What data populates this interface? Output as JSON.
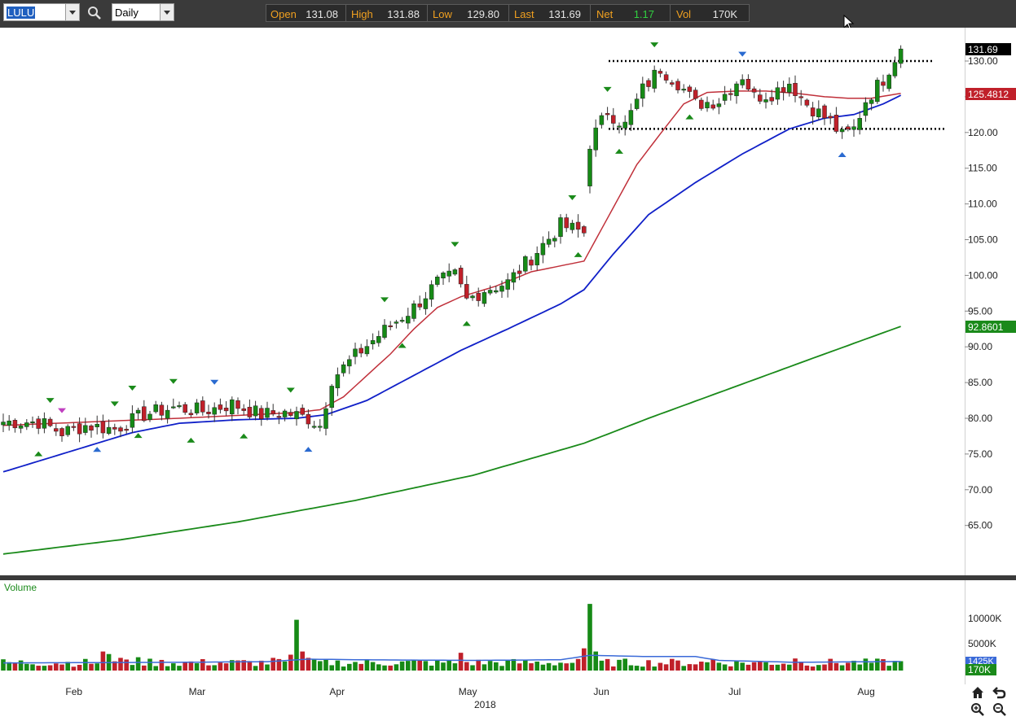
{
  "toolbar": {
    "symbol": "LULU",
    "interval": "Daily",
    "quote": [
      {
        "label": "Open",
        "value": "131.08"
      },
      {
        "label": "High",
        "value": "131.88"
      },
      {
        "label": "Low",
        "value": "129.80"
      },
      {
        "label": "Last",
        "value": "131.69"
      },
      {
        "label": "Net",
        "value": "1.17"
      },
      {
        "label": "Vol",
        "value": "170K"
      }
    ]
  },
  "colors": {
    "up": "#168a16",
    "down": "#c0202a",
    "ma_short": "#c0303a",
    "ma_mid": "#1020c8",
    "ma_long": "#1a8a1a",
    "marker_green": "#1a8a1a",
    "marker_blue": "#2a6ad0",
    "marker_magenta": "#c040c0",
    "vol_avg": "#3a6ad8"
  },
  "chart_data": {
    "type": "candlestick",
    "title": "",
    "y_ticks": [
      "130.00",
      "125.00",
      "120.00",
      "115.00",
      "110.00",
      "105.00",
      "100.00",
      "95.00",
      "90.00",
      "85.00",
      "80.00",
      "75.00",
      "70.00",
      "65.00"
    ],
    "ylim": [
      60.5,
      133.5
    ],
    "x_ticks": [
      "Feb",
      "Mar",
      "Apr",
      "May",
      "Jun",
      "Jul",
      "Aug"
    ],
    "x_year": "2018",
    "last_price_label": "131.69",
    "ma_short_label": "125.4812",
    "ma_long_label": "92.8601",
    "resistance_level": 130.0,
    "support_level": 120.5,
    "price_anchors": [
      [
        0,
        79.5
      ],
      [
        6,
        79.5
      ],
      [
        10,
        78.0
      ],
      [
        14,
        79.0
      ],
      [
        19,
        78.5
      ],
      [
        24,
        80.5
      ],
      [
        29,
        81.5
      ],
      [
        34,
        81.0
      ],
      [
        39,
        82.0
      ],
      [
        44,
        80.5
      ],
      [
        48,
        80.8
      ],
      [
        52,
        80.0
      ],
      [
        54,
        79.0
      ],
      [
        56,
        85.5
      ],
      [
        61,
        89.5
      ],
      [
        66,
        93.0
      ],
      [
        70,
        95.5
      ],
      [
        74,
        99.0
      ],
      [
        77,
        100.0
      ],
      [
        79,
        96.5
      ],
      [
        82,
        98.0
      ],
      [
        86,
        99.0
      ],
      [
        90,
        102.5
      ],
      [
        95,
        107.0
      ],
      [
        99,
        106.0
      ],
      [
        100,
        118.5
      ],
      [
        103,
        123.0
      ],
      [
        106,
        121.0
      ],
      [
        109,
        126.0
      ],
      [
        112,
        129.0
      ],
      [
        115,
        127.0
      ],
      [
        118,
        124.0
      ],
      [
        122,
        124.5
      ],
      [
        126,
        128.0
      ],
      [
        128,
        125.0
      ],
      [
        131,
        125.5
      ],
      [
        134,
        127.0
      ],
      [
        137,
        124.0
      ],
      [
        141,
        121.5
      ],
      [
        143,
        119.5
      ],
      [
        145,
        120.5
      ],
      [
        147,
        124.5
      ],
      [
        150,
        127.5
      ],
      [
        152,
        130.5
      ],
      [
        153,
        131.69
      ]
    ],
    "ma_short": [
      [
        0,
        79.0
      ],
      [
        15,
        79.5
      ],
      [
        30,
        80.0
      ],
      [
        50,
        80.8
      ],
      [
        54,
        81.2
      ],
      [
        58,
        83.0
      ],
      [
        62,
        86.0
      ],
      [
        66,
        89.0
      ],
      [
        70,
        92.5
      ],
      [
        74,
        95.5
      ],
      [
        78,
        97.0
      ],
      [
        84,
        98.5
      ],
      [
        90,
        100.5
      ],
      [
        99,
        102.0
      ],
      [
        103,
        108.0
      ],
      [
        108,
        115.5
      ],
      [
        112,
        119.8
      ],
      [
        116,
        124.0
      ],
      [
        120,
        125.6
      ],
      [
        125,
        125.8
      ],
      [
        130,
        125.8
      ],
      [
        135,
        125.5
      ],
      [
        140,
        125.0
      ],
      [
        144,
        124.8
      ],
      [
        148,
        124.8
      ],
      [
        153,
        125.48
      ]
    ],
    "ma_mid": [
      [
        0,
        72.5
      ],
      [
        14,
        76.0
      ],
      [
        22,
        78.0
      ],
      [
        30,
        79.3
      ],
      [
        40,
        79.8
      ],
      [
        50,
        80.0
      ],
      [
        55,
        80.5
      ],
      [
        62,
        82.5
      ],
      [
        70,
        86.0
      ],
      [
        78,
        89.5
      ],
      [
        86,
        92.5
      ],
      [
        95,
        96.0
      ],
      [
        99,
        98.0
      ],
      [
        104,
        103.0
      ],
      [
        110,
        108.5
      ],
      [
        118,
        113.0
      ],
      [
        126,
        117.0
      ],
      [
        134,
        120.5
      ],
      [
        140,
        122.0
      ],
      [
        145,
        122.5
      ],
      [
        150,
        124.0
      ],
      [
        153,
        125.2
      ]
    ],
    "ma_long": [
      [
        0,
        61.0
      ],
      [
        20,
        63.0
      ],
      [
        40,
        65.5
      ],
      [
        60,
        68.5
      ],
      [
        80,
        72.0
      ],
      [
        99,
        76.5
      ],
      [
        110,
        80.0
      ],
      [
        125,
        84.5
      ],
      [
        140,
        89.0
      ],
      [
        153,
        92.86
      ]
    ],
    "markers": [
      {
        "i": 6,
        "dir": "up",
        "color": "green"
      },
      {
        "i": 8,
        "dir": "down",
        "color": "green"
      },
      {
        "i": 10,
        "dir": "down",
        "color": "magenta"
      },
      {
        "i": 16,
        "dir": "up",
        "color": "blue"
      },
      {
        "i": 19,
        "dir": "down",
        "color": "green"
      },
      {
        "i": 22,
        "dir": "down",
        "color": "green"
      },
      {
        "i": 23,
        "dir": "up",
        "color": "green"
      },
      {
        "i": 29,
        "dir": "down",
        "color": "green"
      },
      {
        "i": 32,
        "dir": "up",
        "color": "green"
      },
      {
        "i": 36,
        "dir": "down",
        "color": "blue"
      },
      {
        "i": 41,
        "dir": "up",
        "color": "green"
      },
      {
        "i": 49,
        "dir": "down",
        "color": "green"
      },
      {
        "i": 52,
        "dir": "up",
        "color": "blue"
      },
      {
        "i": 65,
        "dir": "down",
        "color": "green"
      },
      {
        "i": 68,
        "dir": "up",
        "color": "green"
      },
      {
        "i": 77,
        "dir": "down",
        "color": "green"
      },
      {
        "i": 79,
        "dir": "up",
        "color": "green"
      },
      {
        "i": 97,
        "dir": "down",
        "color": "green"
      },
      {
        "i": 98,
        "dir": "up",
        "color": "green"
      },
      {
        "i": 103,
        "dir": "down",
        "color": "green"
      },
      {
        "i": 105,
        "dir": "up",
        "color": "green"
      },
      {
        "i": 111,
        "dir": "down",
        "color": "green"
      },
      {
        "i": 117,
        "dir": "up",
        "color": "green"
      },
      {
        "i": 126,
        "dir": "down",
        "color": "blue"
      },
      {
        "i": 143,
        "dir": "up",
        "color": "blue"
      }
    ],
    "volume": {
      "label": "Volume",
      "y_ticks": [
        "10000K",
        "5000K"
      ],
      "ylim": [
        0,
        12000
      ],
      "avg_label": "1425K",
      "last_label": "170K",
      "spikes": [
        [
          17,
          3000
        ],
        [
          18,
          2600
        ],
        [
          20,
          2000
        ],
        [
          23,
          2100
        ],
        [
          46,
          2000
        ],
        [
          49,
          2500
        ],
        [
          50,
          8000
        ],
        [
          51,
          3000
        ],
        [
          52,
          2000
        ],
        [
          78,
          2800
        ],
        [
          99,
          3500
        ],
        [
          100,
          10500
        ],
        [
          101,
          3000
        ],
        [
          121,
          1800
        ],
        [
          135,
          1900
        ]
      ],
      "avg": [
        [
          0,
          1200
        ],
        [
          30,
          1300
        ],
        [
          45,
          1400
        ],
        [
          52,
          1800
        ],
        [
          60,
          1700
        ],
        [
          80,
          1600
        ],
        [
          95,
          1700
        ],
        [
          100,
          2400
        ],
        [
          110,
          2200
        ],
        [
          118,
          2200
        ],
        [
          122,
          1600
        ],
        [
          135,
          1300
        ],
        [
          153,
          1425
        ]
      ]
    }
  },
  "nav": {
    "icons": [
      "home-icon",
      "undo-icon",
      "zoom-in-icon",
      "zoom-out-icon"
    ]
  }
}
